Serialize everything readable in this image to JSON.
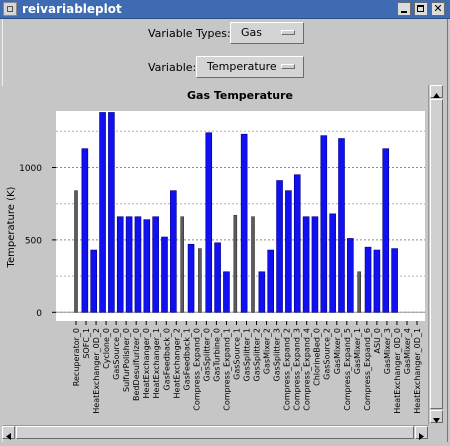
{
  "window": {
    "title": "reivariableplot"
  },
  "controls": {
    "variable_types_label": "Variable Types:",
    "variable_types_value": "Gas",
    "variable_label": "Variable:",
    "variable_value": "Temperature"
  },
  "chart_data": {
    "type": "bar",
    "title": "Gas Temperature",
    "ylabel": "Temperature (K)",
    "xlabel": "",
    "ylim": [
      -60,
      1390
    ],
    "yticks": [
      0,
      500,
      1000
    ],
    "grid": true,
    "legend": "none",
    "colors": {
      "primary": "#1010f0",
      "secondary": "#5c5c5c"
    },
    "categories": [
      "Recuperator_0",
      "SOFC_1",
      "HeatExchanger_0D_2",
      "Cyclone_0",
      "GasSource_0",
      "SulfurPolisher_0",
      "BedDesulfurizer_0",
      "HeatExchanger_0",
      "HeatExchanger_1",
      "GasFeedback_0",
      "HeatExchanger_2",
      "GasFeedback_1",
      "Compress_Expand_0",
      "GasSplitter_0",
      "GasTurbine_0",
      "Compress_Expand_1",
      "GasSource_1",
      "GasSplitter_1",
      "GasSplitter_2",
      "GasMixer_2",
      "GasSplitter_3",
      "Compress_Expand_2",
      "Compress_Expand_3",
      "Compress_Expand_4",
      "ChlorineBed_0",
      "GasSource_2",
      "GasMixer_0",
      "Compress_Expand_5",
      "GasMixer_1",
      "Compress_Expand_6",
      "ASU_0",
      "GasMixer_3",
      "HeatExchanger_0D_0",
      "GasMixer_4",
      "HeatExchanger_0D_1"
    ],
    "series": [
      {
        "values": [
          840,
          1130,
          430,
          1380,
          1380,
          660,
          660,
          660,
          640,
          660,
          520,
          840,
          660,
          470,
          440,
          1240,
          480,
          280,
          670,
          1230,
          660,
          280,
          430,
          910,
          840,
          950,
          660,
          660,
          1220,
          680,
          1200,
          510,
          280,
          450,
          430,
          1130,
          440
        ]
      }
    ],
    "bar_highlight": [
      false,
      true,
      true,
      true,
      true,
      true,
      true,
      true,
      true,
      true,
      true,
      true,
      false,
      true,
      false,
      true,
      true,
      true,
      false,
      true,
      false,
      true,
      true,
      true,
      true,
      true,
      true,
      true,
      true,
      true,
      true,
      true,
      false,
      true,
      true,
      true,
      true
    ]
  },
  "scrollbars": {
    "vertical": "vertical-scrollbar",
    "horizontal": "horizontal-scrollbar"
  }
}
